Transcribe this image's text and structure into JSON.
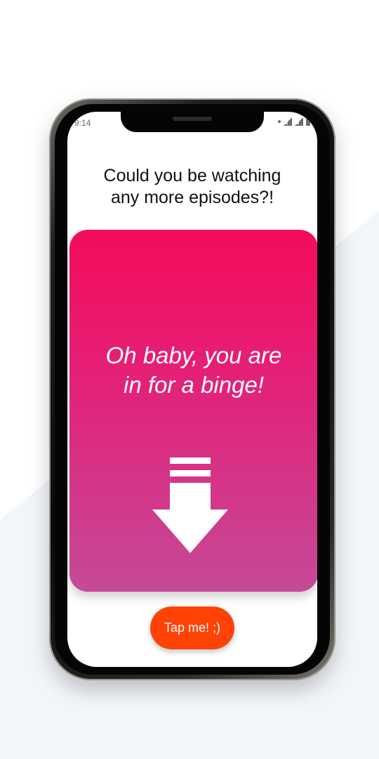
{
  "status_bar": {
    "time": "9:14",
    "icons": [
      "notification-dot-icon",
      "signal-x-icon",
      "signal-x-icon",
      "battery-icon"
    ]
  },
  "screen": {
    "heading_line1": "Could you be watching",
    "heading_line2": "any more episodes?!",
    "card": {
      "text_line1": "Oh baby, you are",
      "text_line2": "in for a binge!",
      "icon": "down-arrow-icon",
      "gradient_top": "#f40b5b",
      "gradient_bottom": "#c54a98"
    },
    "button_label": "Tap me! ;)",
    "button_color": "#ff4307"
  }
}
